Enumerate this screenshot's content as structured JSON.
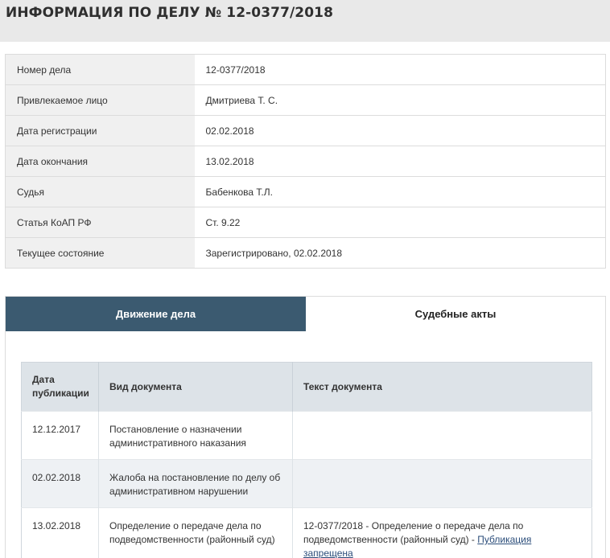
{
  "header": {
    "title": "ИНФОРМАЦИЯ ПО ДЕЛУ № 12-0377/2018"
  },
  "case_info": [
    {
      "label": "Номер дела",
      "value": "12-0377/2018"
    },
    {
      "label": "Привлекаемое лицо",
      "value": "Дмитриева Т. С."
    },
    {
      "label": "Дата регистрации",
      "value": "02.02.2018"
    },
    {
      "label": "Дата окончания",
      "value": "13.02.2018"
    },
    {
      "label": "Судья",
      "value": "Бабенкова Т.Л."
    },
    {
      "label": "Статья КоАП РФ",
      "value": "Ст. 9.22"
    },
    {
      "label": "Текущее состояние",
      "value": "Зарегистрировано, 02.02.2018"
    }
  ],
  "tabs": [
    {
      "label": "Движение дела",
      "active": true
    },
    {
      "label": "Судебные акты",
      "active": false
    }
  ],
  "events_table": {
    "headers": {
      "date": "Дата публикации",
      "doc_type": "Вид документа",
      "doc_text": "Текст документа"
    },
    "rows": [
      {
        "date": "12.12.2017",
        "doc_type": "Постановление о назначении административного наказания",
        "doc_text": "",
        "link": ""
      },
      {
        "date": "02.02.2018",
        "doc_type": "Жалоба на постановление по делу об административном нарушении",
        "doc_text": "",
        "link": ""
      },
      {
        "date": "13.02.2018",
        "doc_type": "Определение о передаче дела по подведомственности (районный суд)",
        "doc_text": "12-0377/2018 - Определение о передаче дела по подведомственности (районный суд) - ",
        "link": "Публикация запрещена"
      }
    ]
  },
  "colors": {
    "active_tab": "#3b5a70",
    "header_bg": "#e9e9e9",
    "label_bg": "#f0f0f0",
    "table_head_bg": "#dde3e8",
    "link": "#2b4d7a"
  }
}
